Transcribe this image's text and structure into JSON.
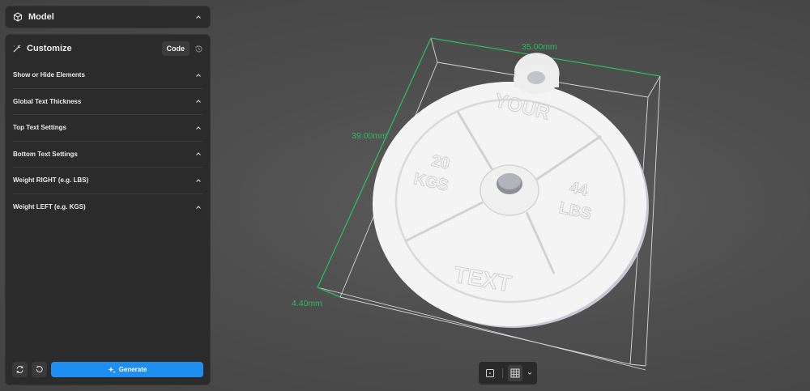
{
  "model_panel": {
    "title": "Model",
    "icon": "cube-icon"
  },
  "customize_panel": {
    "title": "Customize",
    "icon": "wand-icon",
    "code_label": "Code",
    "sections": [
      {
        "label": "Show or Hide Elements"
      },
      {
        "label": "Global Text Thickness"
      },
      {
        "label": "Top Text Settings"
      },
      {
        "label": "Bottom Text Settings"
      },
      {
        "label": "Weight RIGHT (e.g. LBS)"
      },
      {
        "label": "Weight LEFT (e.g. KGS)"
      }
    ],
    "generate_label": "Generate"
  },
  "viewport": {
    "dimensions": {
      "width": "35.00mm",
      "height": "39.00mm",
      "depth": "4.40mm"
    },
    "model_text": {
      "top": "YOUR",
      "bottom": "TEXT",
      "left_value": "20",
      "left_unit": "KGS",
      "right_value": "44",
      "right_unit": "LBS"
    }
  },
  "colors": {
    "accent": "#1e8ef0",
    "dimension": "#2dbb59",
    "panel_bg": "#2b2b2b",
    "model": "#f2f2f2"
  }
}
